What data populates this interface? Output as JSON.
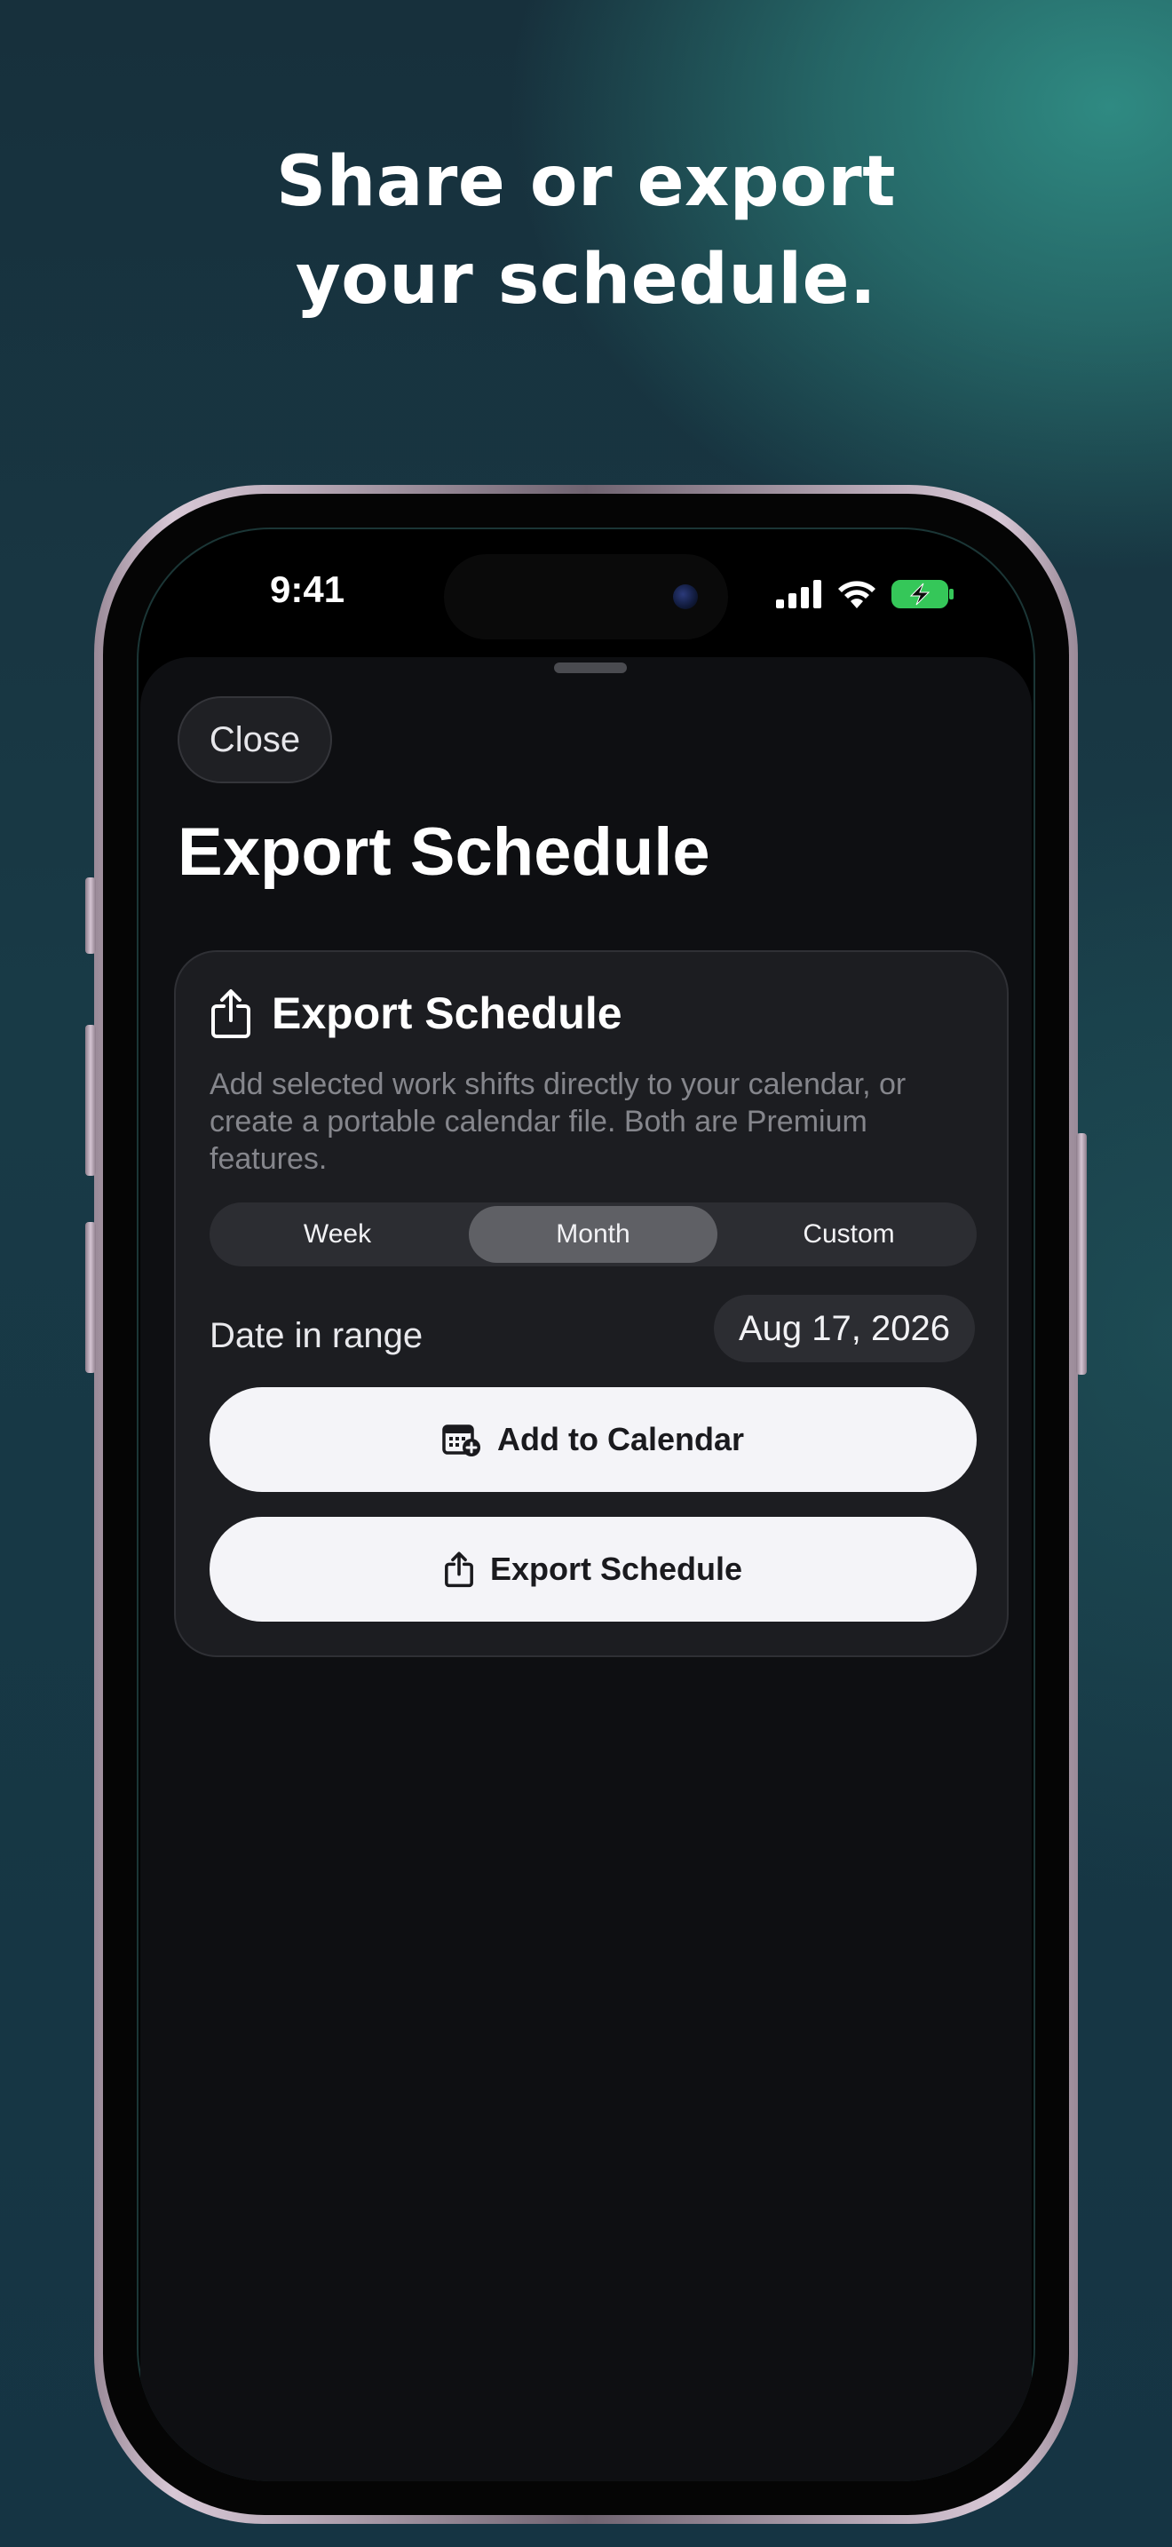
{
  "promo": {
    "headline_line1": "Share or export",
    "headline_line2": "your schedule."
  },
  "status_bar": {
    "time": "9:41"
  },
  "sheet": {
    "close_label": "Close",
    "title": "Export Schedule"
  },
  "card": {
    "title": "Export Schedule",
    "description": "Add selected work shifts directly to your calendar, or create a portable calendar file. Both are Premium features.",
    "segments": [
      {
        "label": "Week"
      },
      {
        "label": "Month"
      },
      {
        "label": "Custom"
      }
    ],
    "selected_segment": "Month",
    "range_label": "Date in range",
    "range_date": "Aug 17, 2026",
    "add_to_calendar_label": "Add to Calendar",
    "export_label": "Export Schedule"
  },
  "icons": {
    "share": "share-icon",
    "calendar_add": "calendar-add-icon",
    "signal": "signal-icon",
    "wifi": "wifi-icon",
    "battery": "battery-charging-icon"
  },
  "colors": {
    "sheet_bg": "#0e0f12",
    "card_bg": "#1c1d21",
    "button_bg": "#f4f4f8",
    "battery_green": "#35c759"
  }
}
